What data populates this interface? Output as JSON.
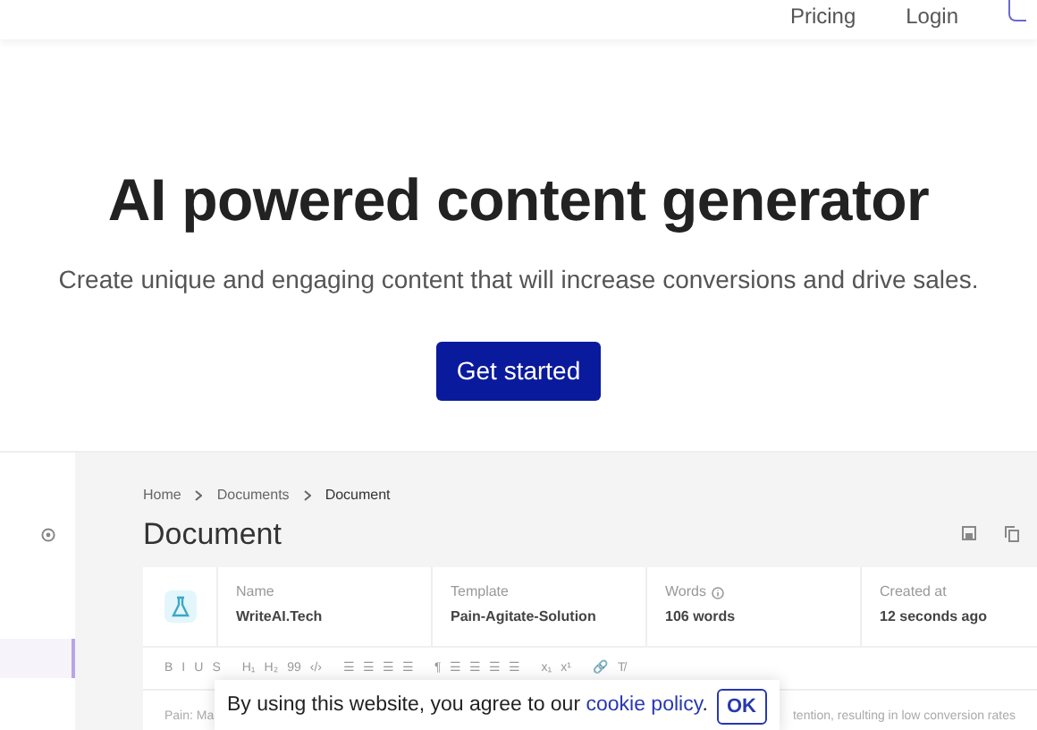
{
  "nav": {
    "links": [
      "Pricing",
      "Login"
    ]
  },
  "hero": {
    "title": "AI powered content generator",
    "subtitle": "Create unique and engaging content that will increase conversions and drive sales.",
    "button": "Get started"
  },
  "app": {
    "sidebar": {
      "items": [
        {
          "selected": true
        }
      ]
    },
    "breadcrumb": [
      "Home",
      "Documents",
      "Document"
    ],
    "title": "Document",
    "fields": [
      {
        "label": "Name",
        "value": "WriteAI.Tech",
        "info": false
      },
      {
        "label": "Template",
        "value": "Pain-Agitate-Solution",
        "info": false
      },
      {
        "label": "Words",
        "value": "106 words",
        "info": true
      },
      {
        "label": "Created at",
        "value": "12 seconds ago",
        "info": false
      }
    ],
    "toolbar": [
      [
        "B",
        "I",
        "U",
        "S"
      ],
      [
        "H₁",
        "H₂",
        "99",
        "‹/›"
      ],
      [
        "☰",
        "☰",
        "☰",
        "☰"
      ],
      [
        "¶",
        "☰",
        "☰",
        "☰",
        "☰"
      ],
      [
        "x₁",
        "x¹"
      ],
      [
        "🔗",
        "T̸"
      ]
    ],
    "editor_text_left": "Pain: Ma",
    "editor_text_right": "tention, resulting in low conversion rates"
  },
  "cookie": {
    "text": "By using this website, you agree to our ",
    "link": "cookie policy",
    "after": ".",
    "button": "OK"
  }
}
